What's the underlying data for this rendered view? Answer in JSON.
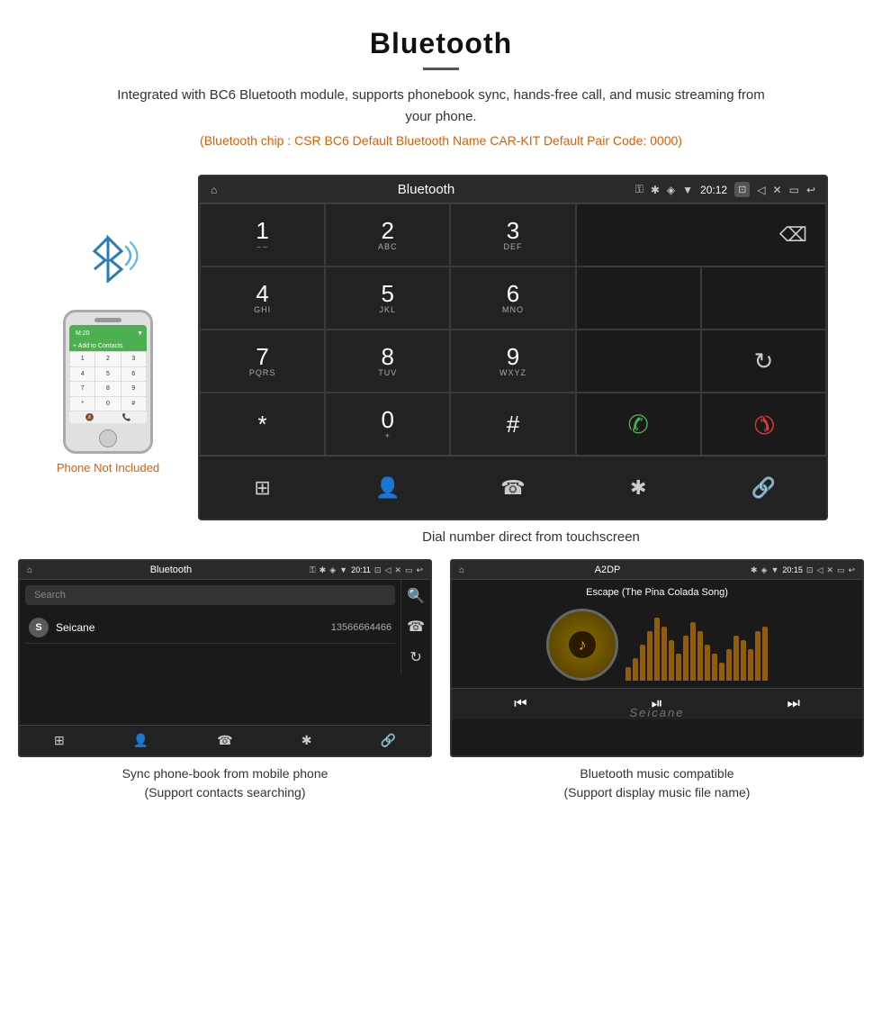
{
  "header": {
    "title": "Bluetooth",
    "description": "Integrated with BC6 Bluetooth module, supports phonebook sync, hands-free call, and music streaming from your phone.",
    "specs": "(Bluetooth chip : CSR BC6   Default Bluetooth Name CAR-KIT    Default Pair Code: 0000)"
  },
  "phone_aside": {
    "not_included": "Phone Not Included"
  },
  "car_screen": {
    "statusbar": {
      "title": "Bluetooth",
      "time": "20:12"
    },
    "dialpad": {
      "keys": [
        {
          "num": "1",
          "sub": "⌣⌣"
        },
        {
          "num": "2",
          "sub": "ABC"
        },
        {
          "num": "3",
          "sub": "DEF"
        },
        {
          "num": "4",
          "sub": "GHI"
        },
        {
          "num": "5",
          "sub": "JKL"
        },
        {
          "num": "6",
          "sub": "MNO"
        },
        {
          "num": "7",
          "sub": "PQRS"
        },
        {
          "num": "8",
          "sub": "TUV"
        },
        {
          "num": "9",
          "sub": "WXYZ"
        },
        {
          "num": "*",
          "sub": ""
        },
        {
          "num": "0",
          "sub": "+"
        },
        {
          "num": "#",
          "sub": ""
        }
      ]
    },
    "caption": "Dial number direct from touchscreen"
  },
  "phonebook_screen": {
    "statusbar": {
      "title": "Bluetooth",
      "time": "20:11"
    },
    "search_placeholder": "Search",
    "contacts": [
      {
        "letter": "S",
        "name": "Seicane",
        "phone": "13566664466"
      }
    ],
    "caption_line1": "Sync phone-book from mobile phone",
    "caption_line2": "(Support contacts searching)"
  },
  "music_screen": {
    "statusbar": {
      "title": "A2DP",
      "time": "20:15"
    },
    "song_title": "Escape (The Pina Colada Song)",
    "viz_heights": [
      15,
      25,
      40,
      55,
      70,
      60,
      45,
      30,
      50,
      65,
      55,
      40,
      30,
      20,
      35,
      50,
      45,
      35,
      55,
      60
    ],
    "caption_line1": "Bluetooth music compatible",
    "caption_line2": "(Support display music file name)"
  },
  "icons": {
    "home": "⌂",
    "usb": "⚿",
    "bluetooth_status": "✱",
    "location": "◈",
    "wifi": "▼",
    "camera": "⊡",
    "volume": "◁",
    "close": "✕",
    "window": "▭",
    "back": "↩",
    "backspace": "⌫",
    "redial": "↻",
    "call_green": "📞",
    "call_red": "📵",
    "grid": "⊞",
    "person": "👤",
    "phone_nav": "☎",
    "bluetooth_nav": "✱",
    "link": "🔗",
    "search": "🔍",
    "music_note": "♪",
    "prev": "⏮",
    "play_pause": "⏯",
    "next": "⏭"
  }
}
